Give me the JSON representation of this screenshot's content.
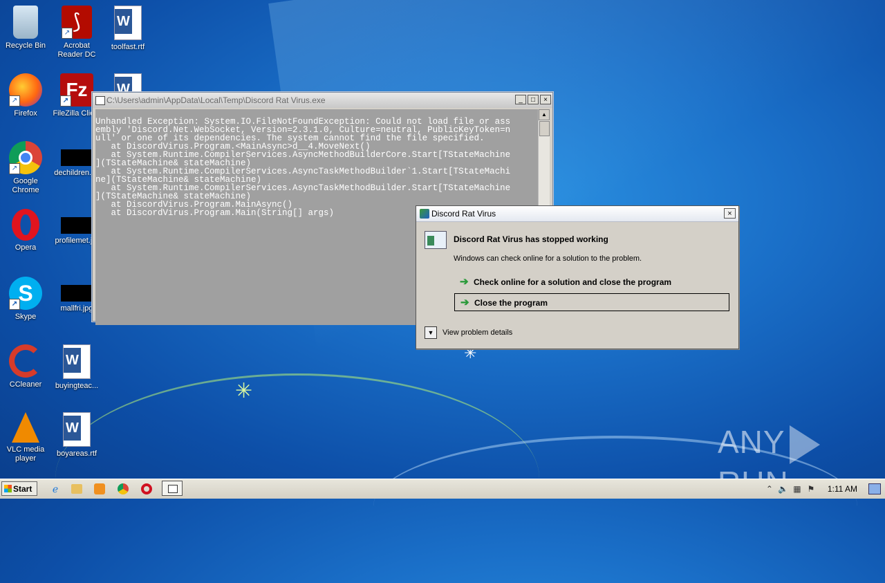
{
  "desktop_icons": [
    {
      "label": "Recycle Bin",
      "icon": "recycle-bin-icon"
    },
    {
      "label": "Acrobat Reader DC",
      "icon": "acrobat-icon"
    },
    {
      "label": "toolfast.rtf",
      "icon": "word-doc-icon"
    },
    {
      "label": "Firefox",
      "icon": "firefox-icon"
    },
    {
      "label": "FileZilla Clie...",
      "icon": "filezilla-icon"
    },
    {
      "label": "Google Chrome",
      "icon": "chrome-icon"
    },
    {
      "label": "dechildren.j...",
      "icon": "image-file-icon"
    },
    {
      "label": "Opera",
      "icon": "opera-icon"
    },
    {
      "label": "profilemet.j...",
      "icon": "image-file-icon"
    },
    {
      "label": "Skype",
      "icon": "skype-icon"
    },
    {
      "label": "mallfri.jpg",
      "icon": "image-file-icon"
    },
    {
      "label": "CCleaner",
      "icon": "ccleaner-icon"
    },
    {
      "label": "buyingteac...",
      "icon": "word-doc-icon"
    },
    {
      "label": "VLC media player",
      "icon": "vlc-icon"
    },
    {
      "label": "boyareas.rtf",
      "icon": "word-doc-icon"
    }
  ],
  "console": {
    "title": "C:\\Users\\admin\\AppData\\Local\\Temp\\Discord Rat Virus.exe",
    "lines": [
      "Unhandled Exception: System.IO.FileNotFoundException: Could not load file or ass",
      "embly 'Discord.Net.WebSocket, Version=2.3.1.0, Culture=neutral, PublicKeyToken=n",
      "ull' or one of its dependencies. The system cannot find the file specified.",
      "   at DiscordVirus.Program.<MainAsync>d__4.MoveNext()",
      "   at System.Runtime.CompilerServices.AsyncMethodBuilderCore.Start[TStateMachine",
      "](TStateMachine& stateMachine)",
      "   at System.Runtime.CompilerServices.AsyncTaskMethodBuilder`1.Start[TStateMachi",
      "ne](TStateMachine& stateMachine)",
      "   at System.Runtime.CompilerServices.AsyncTaskMethodBuilder.Start[TStateMachine",
      "](TStateMachine& stateMachine)",
      "   at DiscordVirus.Program.MainAsync()",
      "   at DiscordVirus.Program.Main(String[] args)"
    ],
    "minimize": "_",
    "maximize": "□",
    "close": "×"
  },
  "dialog": {
    "title": "Discord Rat Virus",
    "heading": "Discord Rat Virus has stopped working",
    "subtext": "Windows can check online for a solution to the problem.",
    "option1": "Check online for a solution and close the program",
    "option2": "Close the program",
    "details": "View problem details",
    "close": "×"
  },
  "watermark": {
    "left": "ANY",
    "right": "RUN"
  },
  "taskbar": {
    "start_label": "Start",
    "clock": "1:11 AM"
  }
}
